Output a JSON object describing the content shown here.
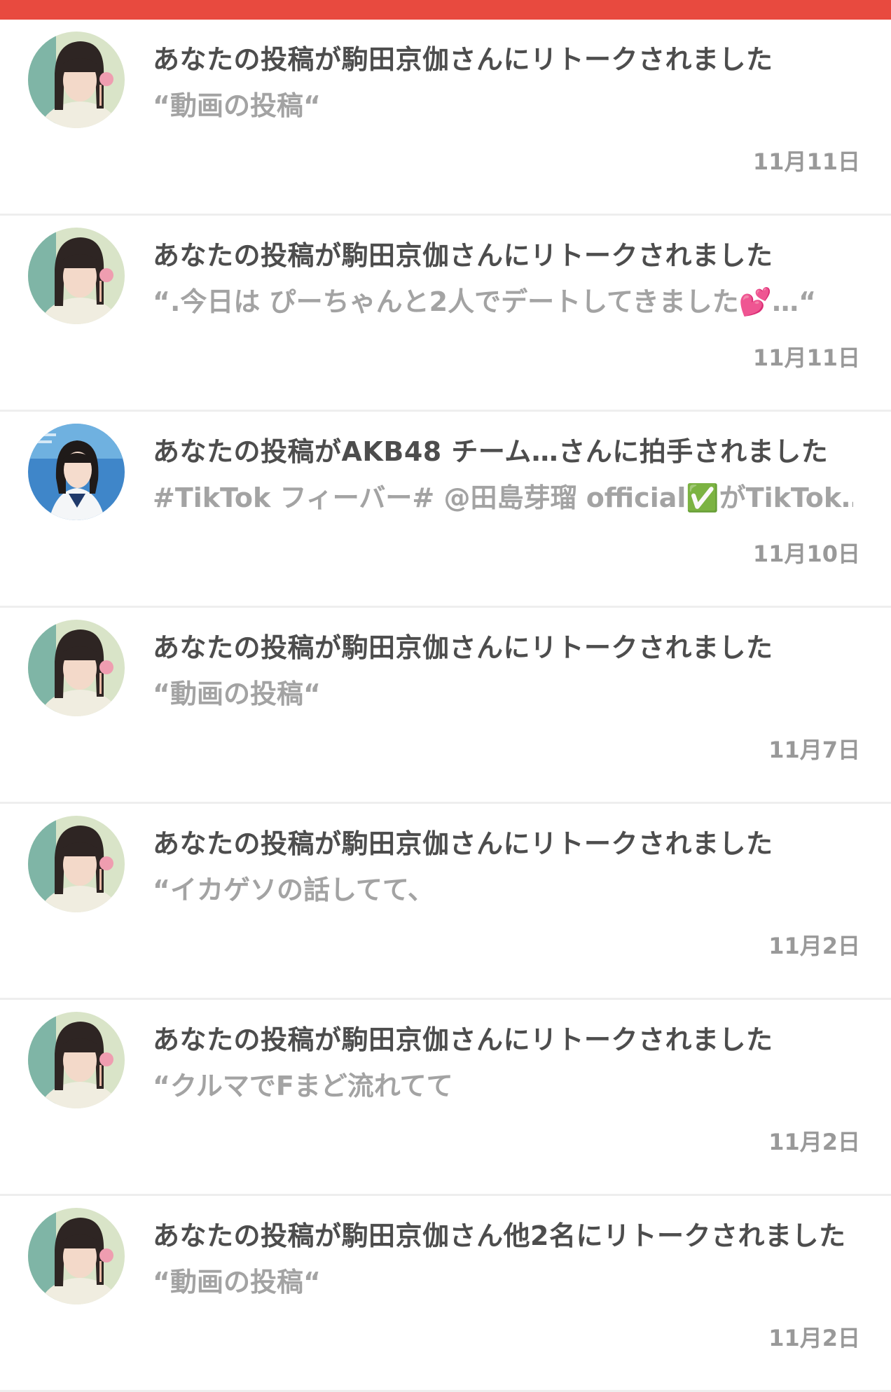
{
  "colors": {
    "header_accent": "#e84a3f",
    "title_text": "#4d4d4d",
    "snippet_text": "#a3a3a3",
    "date_text": "#999999"
  },
  "notifications": [
    {
      "avatar": "avatar-user-a",
      "title": "あなたの投稿が駒田京伽さんにリトークされました",
      "snippet": "“動画の投稿“",
      "date": "11月11日"
    },
    {
      "avatar": "avatar-user-a",
      "title": "あなたの投稿が駒田京伽さんにリトークされました",
      "snippet": "“.今日は ぴーちゃんと2人でデートしてきました💕…“",
      "date": "11月11日"
    },
    {
      "avatar": "avatar-user-b",
      "title": "あなたの投稿がAKB48 チーム…さんに拍手されました",
      "snippet": "#TikTok フィーバー# @田島芽瑠 official✅がTikTok…",
      "date": "11月10日"
    },
    {
      "avatar": "avatar-user-a",
      "title": "あなたの投稿が駒田京伽さんにリトークされました",
      "snippet": "“動画の投稿“",
      "date": "11月7日"
    },
    {
      "avatar": "avatar-user-a",
      "title": "あなたの投稿が駒田京伽さんにリトークされました",
      "snippet": "“イカゲソの話してて、",
      "date": "11月2日"
    },
    {
      "avatar": "avatar-user-a",
      "title": "あなたの投稿が駒田京伽さんにリトークされました",
      "snippet": "“クルマでFまど流れてて",
      "date": "11月2日"
    },
    {
      "avatar": "avatar-user-a",
      "title": "あなたの投稿が駒田京伽さん他2名にリトークされました",
      "snippet": "“動画の投稿“",
      "date": "11月2日"
    }
  ]
}
